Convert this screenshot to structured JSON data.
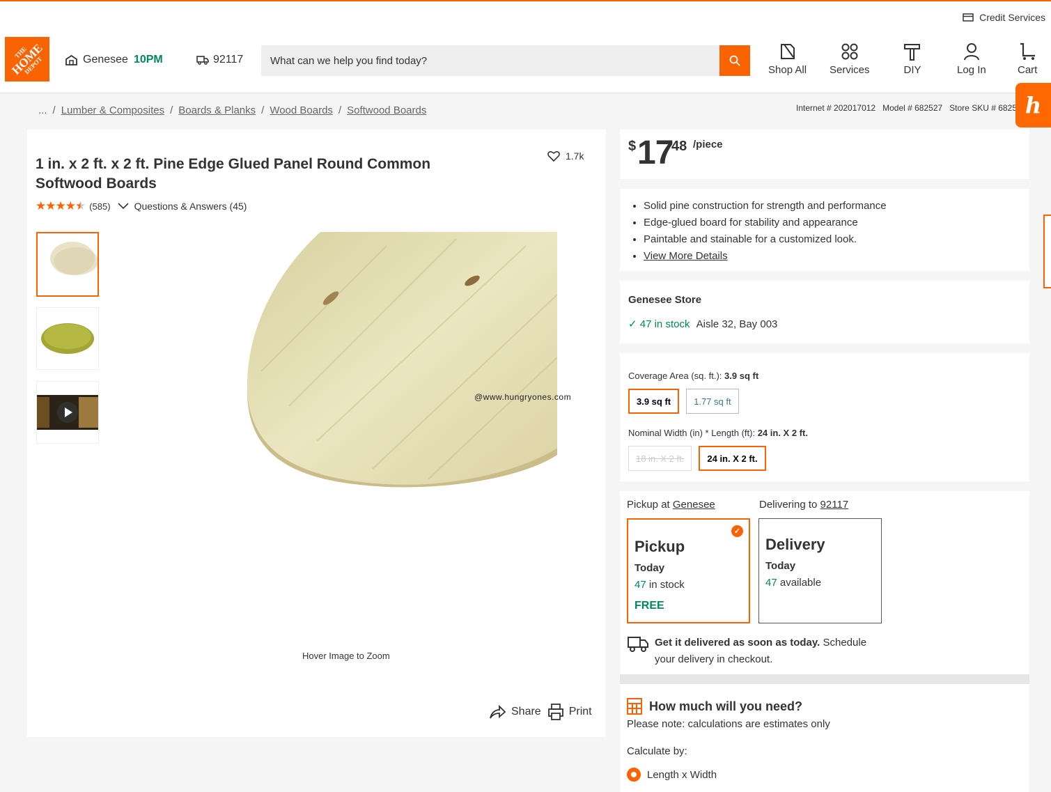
{
  "header": {
    "credit_services": "Credit Services",
    "logo": {
      "line1": "THE",
      "line2": "HOME",
      "line3": "DEPOT"
    },
    "store_name": "Genesee",
    "store_hours": "10PM",
    "zip": "92117",
    "search_placeholder": "What can we help you find today?",
    "nav": {
      "shop_all": "Shop All",
      "services": "Services",
      "diy": "DIY",
      "login": "Log In",
      "cart": "Cart"
    }
  },
  "breadcrumb": {
    "ellipsis": "...",
    "items": [
      "Lumber & Composites",
      "Boards & Planks",
      "Wood Boards",
      "Softwood Boards"
    ]
  },
  "ids": "Internet # 202017012   Model # 682527   Store SKU # 6825",
  "honey_label": "h",
  "product": {
    "title": "1 in. x 2 ft. x 2 ft. Pine Edge Glued Panel Round Common Softwood Boards",
    "favorites": "1.7k",
    "rating_count": "(585)",
    "qa": "Questions & Answers (45)",
    "watermark": "@www.hungryones.com",
    "hover_zoom": "Hover Image to Zoom",
    "share": "Share",
    "print": "Print"
  },
  "price": {
    "dollar": "$",
    "whole": "17",
    "cents": "48",
    "unit": "/piece"
  },
  "highlights": [
    "Solid pine construction for strength and performance",
    "Edge-glued board for stability and appearance",
    "Paintable and stainable for a customized look."
  ],
  "view_more": "View More Details",
  "store": {
    "name": "Genesee Store",
    "stock": "47 in stock",
    "aisle": "Aisle 32, Bay 003"
  },
  "options": {
    "coverage_label": "Coverage Area (sq. ft.):",
    "coverage_value": "3.9 sq ft",
    "coverage_options": [
      "3.9 sq ft",
      "1.77 sq ft"
    ],
    "size_label": "Nominal Width (in) * Length (ft):",
    "size_value": "24 in. X 2 ft.",
    "size_options": [
      "18 in. X 2 ft.",
      "24 in. X 2 ft."
    ]
  },
  "fulfillment": {
    "pickup_at": "Pickup at",
    "pickup_store": "Genesee",
    "delivering_to": "Delivering to",
    "delivery_zip": "92117",
    "pickup": {
      "title": "Pickup",
      "day": "Today",
      "count": "47",
      "stock_text": "in stock",
      "price": "FREE"
    },
    "delivery": {
      "title": "Delivery",
      "day": "Today",
      "count": "47",
      "stock_text": "available"
    },
    "delivery_bold": "Get it delivered as soon as today.",
    "delivery_rest": "Schedule your delivery in checkout."
  },
  "calculator": {
    "question": "How much will you need?",
    "note": "Please note: calculations are estimates only",
    "calc_by": "Calculate by:",
    "option": "Length x Width"
  },
  "colors": {
    "brand": "#f96302",
    "green": "#00875a",
    "blue_link": "#3e7697"
  }
}
